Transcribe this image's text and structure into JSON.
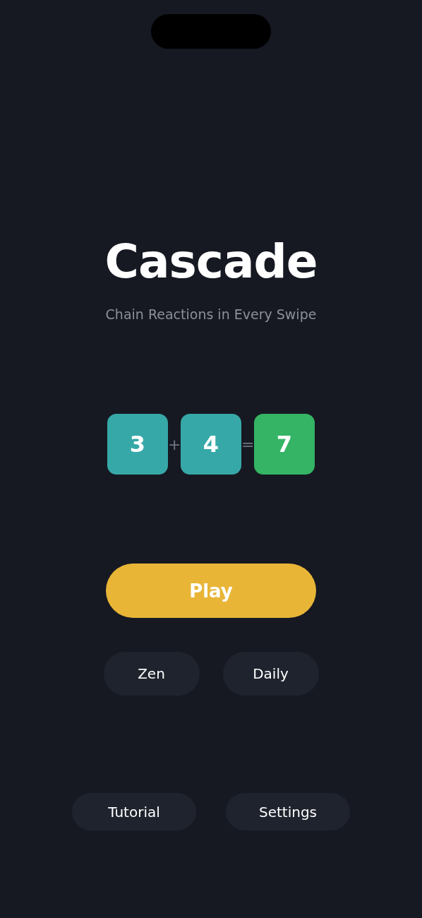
{
  "title": "Cascade",
  "subtitle": "Chain Reactions in Every Swipe",
  "equation": [
    {
      "kind": "tile",
      "text": "3",
      "color": "#37a8a8"
    },
    {
      "kind": "operator",
      "text": "+"
    },
    {
      "kind": "tile",
      "text": "4",
      "color": "#37a8a8"
    },
    {
      "kind": "operator",
      "text": "="
    },
    {
      "kind": "tile",
      "text": "7",
      "color": "#35b465"
    }
  ],
  "primary_button": "Play",
  "mode_buttons": [
    "Zen",
    "Daily"
  ],
  "footer_buttons": [
    "Tutorial",
    "Settings"
  ]
}
